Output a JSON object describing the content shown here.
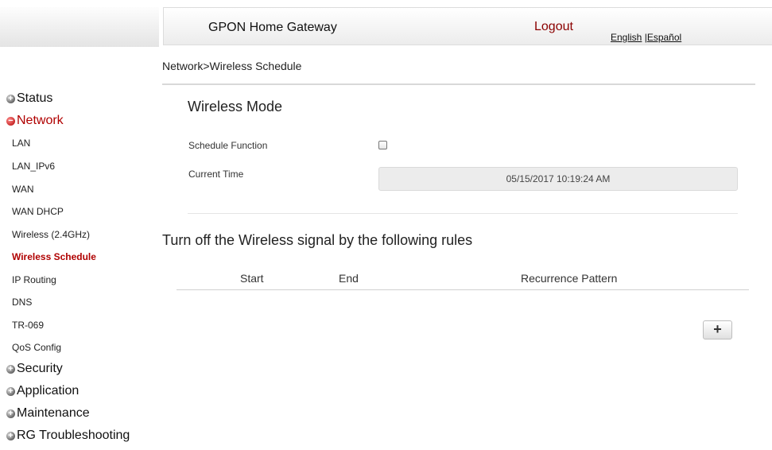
{
  "header": {
    "title": "GPON Home Gateway",
    "logout": "Logout",
    "lang_english": "English",
    "lang_separator": "|",
    "lang_spanish": "Español"
  },
  "breadcrumb": "Network>Wireless Schedule",
  "nav": {
    "status": "Status",
    "network": "Network",
    "network_items": [
      "LAN",
      "LAN_IPv6",
      "WAN",
      "WAN DHCP",
      "Wireless (2.4GHz)",
      "Wireless Schedule",
      "IP Routing",
      "DNS",
      "TR-069",
      "QoS Config"
    ],
    "security": "Security",
    "application": "Application",
    "maintenance": "Maintenance",
    "troubleshooting": "RG Troubleshooting"
  },
  "main": {
    "section_title": "Wireless Mode",
    "schedule_label": "Schedule Function",
    "schedule_checked": false,
    "time_label": "Current Time",
    "time_value": "05/15/2017 10:19:24 AM",
    "rules_title": "Turn off the Wireless signal by the following rules",
    "columns": [
      "Start",
      "End",
      "Recurrence Pattern"
    ],
    "add_button": "+"
  },
  "colors": {
    "accent": "#b00000",
    "logout": "#8b0000"
  }
}
